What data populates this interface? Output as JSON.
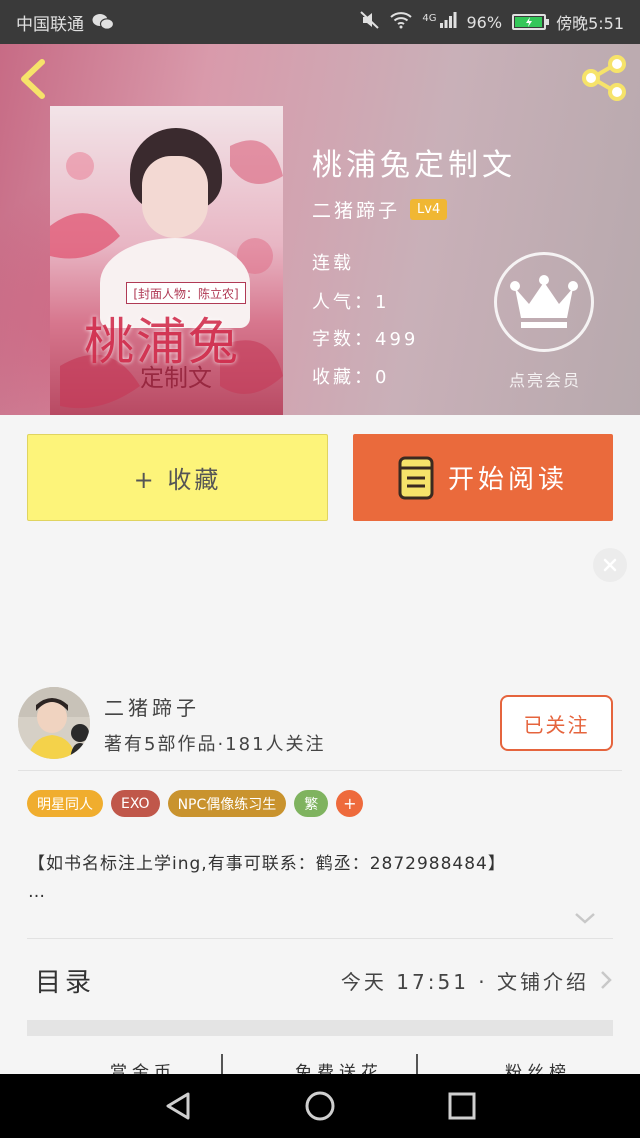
{
  "status_bar": {
    "carrier": "中国联通",
    "network": "4G",
    "battery": "96%",
    "time": "傍晚5:51"
  },
  "book": {
    "title": "桃浦兔定制文",
    "cover_caption": "[封面人物：陈立农]",
    "cover_title": "桃浦兔",
    "cover_subtitle": "定制文",
    "author": "二猪蹄子",
    "level": "Lv4",
    "status": "连载",
    "popularity": "人气：1",
    "word_count": "字数：499",
    "collects": "收藏：0",
    "crown_label": "点亮会员"
  },
  "actions": {
    "collect_label": "+ 收藏",
    "read_label": "开始阅读"
  },
  "author_section": {
    "name": "二猪蹄子",
    "stats": "著有5部作品·181人关注",
    "follow_label": "已关注"
  },
  "tags": [
    {
      "label": "明星同人",
      "color": "#f0ad2e"
    },
    {
      "label": "EXO",
      "color": "#c0574a"
    },
    {
      "label": "NPC偶像练习生",
      "color": "#c9932e"
    },
    {
      "label": "繁",
      "color": "#7fb35f"
    },
    {
      "label": "+",
      "color": "#ee6a3c"
    }
  ],
  "summary": {
    "line1": "【如书名标注上学ing,有事可联系：鹤丞：2872988484】",
    "line2": "…"
  },
  "toc": {
    "label": "目录",
    "info": "今天 17:51 · 文铺介绍"
  },
  "bottom_tabs": {
    "tab1": "赏金币",
    "tab2": "免费送花",
    "tab3": "粉丝榜"
  },
  "colors": {
    "accent_orange": "#ea6a3c",
    "collect_yellow": "#fdf47a",
    "level_badge": "#f0b733"
  }
}
